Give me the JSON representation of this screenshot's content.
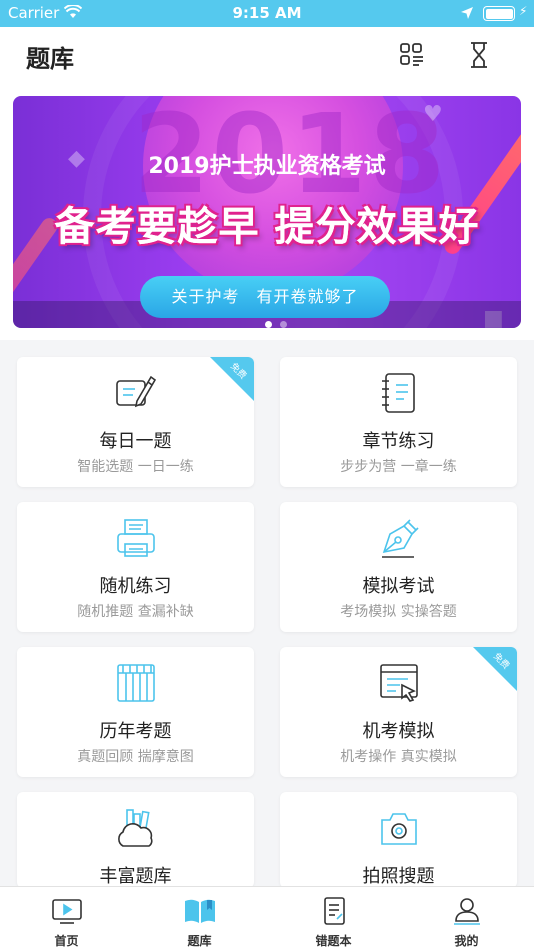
{
  "status": {
    "carrier": "Carrier",
    "time": "9:15 AM"
  },
  "header": {
    "title": "题库"
  },
  "banner": {
    "watermark": "2018",
    "line1": "2019护士执业资格考试",
    "line2": "备考要趁早 提分效果好",
    "pill": "关于护考　有开卷就够了",
    "slides": 2,
    "active_slide": 1
  },
  "cards": [
    {
      "name": "每日一题",
      "sub": "智能选题 一日一练",
      "icon": "daily-question-icon",
      "badge": "免费"
    },
    {
      "name": "章节练习",
      "sub": "步步为营 一章一练",
      "icon": "chapter-notebook-icon",
      "badge": ""
    },
    {
      "name": "随机练习",
      "sub": "随机推题 查漏补缺",
      "icon": "printer-icon",
      "badge": ""
    },
    {
      "name": "模拟考试",
      "sub": "考场模拟 实操答题",
      "icon": "pen-nib-icon",
      "badge": ""
    },
    {
      "name": "历年考题",
      "sub": "真题回顾 揣摩意图",
      "icon": "archive-icon",
      "badge": ""
    },
    {
      "name": "机考模拟",
      "sub": "机考操作 真实模拟",
      "icon": "computer-exam-icon",
      "badge": "免费"
    },
    {
      "name": "丰富题库",
      "sub": "",
      "icon": "cloud-library-icon",
      "badge": ""
    },
    {
      "name": "拍照搜题",
      "sub": "",
      "icon": "camera-icon",
      "badge": ""
    }
  ],
  "tabs": [
    {
      "label": "首页",
      "icon": "home-video-icon",
      "active": false
    },
    {
      "label": "题库",
      "icon": "book-icon",
      "active": true
    },
    {
      "label": "错题本",
      "icon": "notebook-icon",
      "active": false
    },
    {
      "label": "我的",
      "icon": "user-icon",
      "active": false
    }
  ],
  "colors": {
    "accent": "#55c9ee",
    "text": "#222222",
    "subtext": "#9a9a9a",
    "background": "#f4f5f7"
  }
}
